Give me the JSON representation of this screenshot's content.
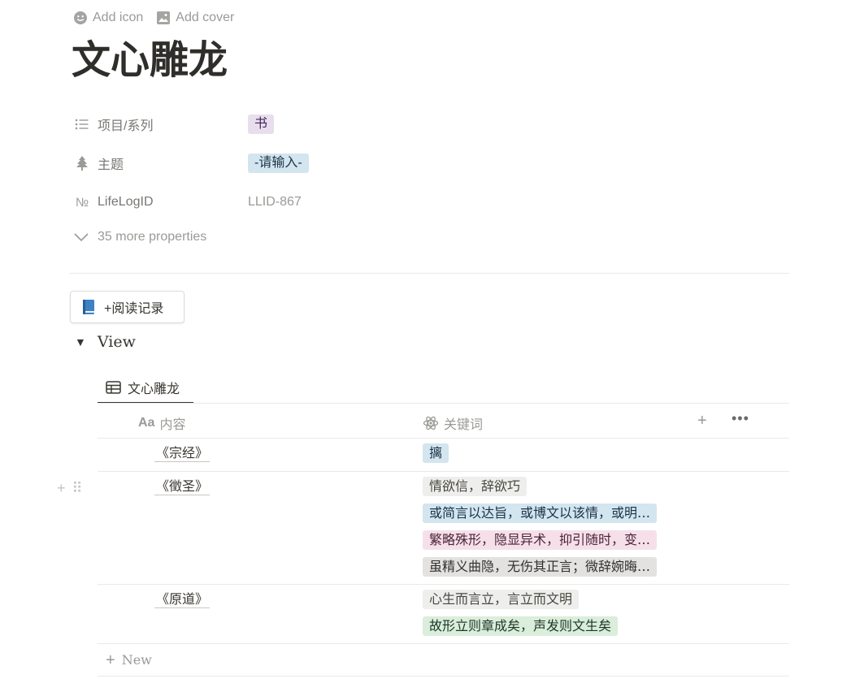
{
  "top_actions": {
    "add_icon": "Add icon",
    "add_cover": "Add cover"
  },
  "page": {
    "title": "文心雕龙"
  },
  "properties": [
    {
      "name": "项目/系列",
      "icon": "list-icon",
      "value": "书",
      "tag_color": "purple"
    },
    {
      "name": "主题",
      "icon": "tree-icon",
      "value": "-请输入-",
      "tag_color": "blue"
    },
    {
      "name": "LifeLogID",
      "icon": "numero-icon",
      "value": "LLID-867"
    }
  ],
  "more_properties": "35 more properties",
  "reading_button": {
    "label": "+阅读记录",
    "icon": "blue-book-icon"
  },
  "view_toggle": {
    "label": "View"
  },
  "database": {
    "tab_label": "文心雕龙",
    "columns": {
      "content": "内容",
      "content_type_icon": "Aa",
      "keywords": "关键词"
    },
    "rows": [
      {
        "name": "《宗经》",
        "tags": [
          {
            "text": "摛",
            "color": "blue"
          }
        ]
      },
      {
        "name": "《徵圣》",
        "tags": [
          {
            "text": "情欲信，辞欲巧",
            "color": "beige"
          },
          {
            "text": "或简言以达旨，或博文以该情，或明…",
            "color": "blue"
          },
          {
            "text": "繁略殊形，隐显异术，抑引随时，变…",
            "color": "pink"
          },
          {
            "text": "虽精义曲隐，无伤其正言；微辞婉晦…",
            "color": "gray"
          }
        ]
      },
      {
        "name": "《原道》",
        "tags": [
          {
            "text": "心生而言立，言立而文明",
            "color": "beige"
          },
          {
            "text": "故形立则章成矣，声发则文生矣",
            "color": "green"
          }
        ]
      }
    ],
    "new_label": "New"
  }
}
